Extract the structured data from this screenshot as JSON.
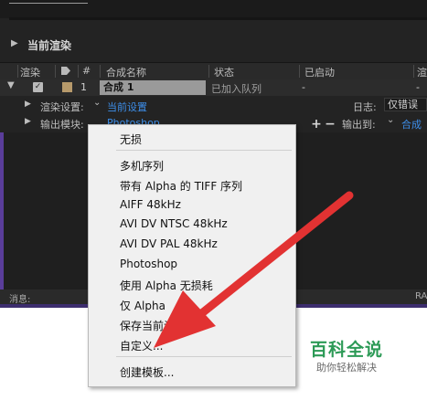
{
  "panel": {
    "section_title": "当前渲染",
    "columns": [
      "渲染",
      "#",
      "合成名称",
      "状态",
      "已启动",
      "渲"
    ],
    "row": {
      "number": "1",
      "comp_name": "合成 1",
      "status": "已加入队列",
      "started": "-",
      "render_time": "-"
    },
    "render_settings_label": "渲染设置:",
    "render_settings_value": "当前设置",
    "log_label": "日志:",
    "log_value": "仅错误",
    "output_module_label": "输出模块:",
    "output_module_value": "Photoshop",
    "output_to_label": "输出到:",
    "output_to_value": "合成",
    "add_symbol": "+",
    "remove_symbol": "−",
    "status_label": "消息:",
    "status_right": "RA"
  },
  "menu": {
    "items": [
      "无损",
      "多机序列",
      "带有 Alpha 的 TIFF 序列",
      "AIFF 48kHz",
      "AVI DV NTSC 48kHz",
      "AVI DV PAL 48kHz",
      "Photoshop",
      "使用 Alpha 无损耗",
      "仅 Alpha",
      "保存当前设",
      "自定义...",
      "创建模板..."
    ]
  },
  "watermark": {
    "title": "百科全说",
    "subtitle": "助你轻松解决"
  },
  "colors": {
    "arrow": "#e23232",
    "accent_blue": "#3d8ee8",
    "watermark_green": "#2c9a56"
  }
}
